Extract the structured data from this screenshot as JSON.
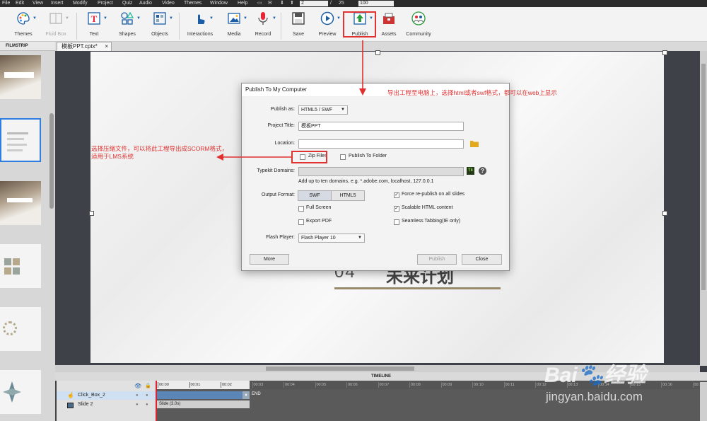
{
  "menubar": {
    "items": [
      "File",
      "Edit",
      "View",
      "Insert",
      "Modify",
      "Project",
      "Quiz",
      "Audio",
      "Video",
      "Themes",
      "Window",
      "Help"
    ],
    "slide_current": "2",
    "slide_separator": "/",
    "slide_total": "25",
    "zoom": "100"
  },
  "toolbar": {
    "buttons": [
      "Themes",
      "Fluid Box",
      "Text",
      "Shapes",
      "Objects",
      "Interactions",
      "Media",
      "Record",
      "Save",
      "Preview",
      "Publish",
      "Assets",
      "Community"
    ]
  },
  "filmstrip": {
    "header": "FILMSTRIP"
  },
  "tab": {
    "title": "模板PPT.cptx*",
    "close": "×"
  },
  "slide": {
    "number": "04",
    "heading": "未来计划"
  },
  "dialog": {
    "title": "Publish To My Computer",
    "publish_as_label": "Publish as:",
    "publish_as_value": "HTML5 / SWF",
    "project_title_label": "Project Title:",
    "project_title_value": "模板PPT",
    "location_label": "Location:",
    "location_value": "",
    "zip_files": "Zip Files",
    "publish_to_folder": "Publish To Folder",
    "typekit_label": "Typekit Domains:",
    "typekit_hint": "Add up to ten domains, e.g. *.adobe.com, localhost, 127.0.0.1",
    "output_format_label": "Output Format:",
    "format_swf": "SWF",
    "format_html5": "HTML5",
    "full_screen": "Full Screen",
    "export_pdf": "Export PDF",
    "force_republish": "Force re-publish on all slides",
    "scalable_html": "Scalable HTML content",
    "seamless_tabbing": "Seamless Tabbing(IE only)",
    "flash_player_label": "Flash Player:",
    "flash_player_value": "Flash Player 10",
    "more_button": "More",
    "publish_button": "Publish",
    "close_button": "Close"
  },
  "timeline": {
    "header": "TIMELINE",
    "rows": [
      "Click_Box_2",
      "Slide 2"
    ],
    "slide_bar": "Slide (3.0s)",
    "end_label": "END",
    "ticks": [
      "00:00",
      "00:01",
      "00:02",
      "00:03",
      "00:04",
      "00:05",
      "00:06",
      "00:07",
      "00:08",
      "00:09",
      "00:10",
      "00:11",
      "00:12",
      "00:13",
      "00:14",
      "00:15",
      "00:16",
      "00:17"
    ]
  },
  "annotations": {
    "publish_note": "导出工程至电脑上，选择html或者swf格式，都可以在web上显示",
    "zip_note_line1": "选择压缩文件，可以将此工程导出成SCORM格式，",
    "zip_note_line2": "适用于LMS系统"
  },
  "watermark": {
    "brand": "Bai",
    "brand2": "经验",
    "url": "jingyan.baidu.com"
  },
  "colors": {
    "annotation": "#e03030",
    "accent": "#1a5ea8"
  }
}
